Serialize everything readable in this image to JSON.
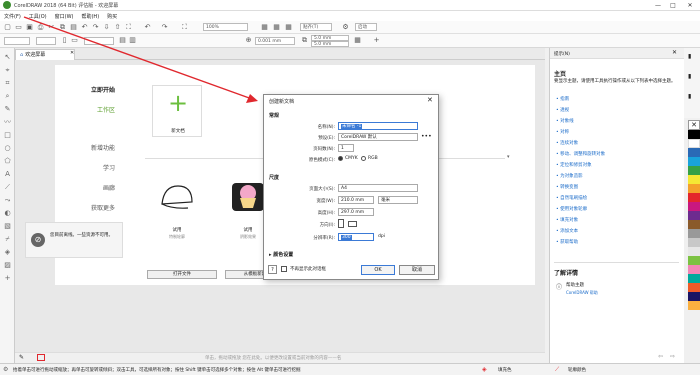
{
  "window": {
    "title": "CorelDRAW 2018 (64 Bit) 评估版 - 欢迎屏幕"
  },
  "menu": [
    "文件(F)",
    "工具(O)",
    "窗口(W)",
    "帮助(H)",
    "购买"
  ],
  "toolbar": {
    "zoom": "100%",
    "snap_label": "贴齐(T)",
    "launch_label": "启动",
    "nudge": "0.001 mm",
    "dup_x": "5.0 mm",
    "dup_y": "5.0 mm"
  },
  "tab": {
    "label": "欢迎屏幕"
  },
  "welcome": {
    "nav": [
      "立即开始",
      "工作区",
      "新增功能",
      "学习",
      "画廊",
      "获取更多"
    ],
    "new_doc": "新文档",
    "tpl1": "试用",
    "tpl1_sub": "特制轮廓",
    "tpl2": "试用",
    "tpl2_sub": "阴影效果",
    "offline": "您目前离线。一些资源不可用。",
    "open_btn": "打开文件",
    "tpl_btn": "从模板新建"
  },
  "dialog": {
    "title": "创建新文档",
    "sec_general": "常规",
    "name_label": "名称(N):",
    "name_value": "未命名 -1",
    "preset_label": "预设(E):",
    "preset_value": "CorelDRAW 默认",
    "pages_label": "页码数(N):",
    "pages_value": "1",
    "color_label": "原色模式(C):",
    "cmyk": "CMYK",
    "rgb": "RGB",
    "sec_size": "尺度",
    "pagesize_label": "页面大小(S):",
    "pagesize_value": "A4",
    "width_label": "宽度(W):",
    "width_value": "210.0 mm",
    "unit_value": "毫米",
    "height_label": "高度(H):",
    "height_value": "297.0 mm",
    "orient_label": "方向(I):",
    "res_label": "分辨率(R):",
    "res_value": "300",
    "dpi": "dpi",
    "sec_color": "颜色设置",
    "dontshow": "不再显示此对话框",
    "ok": "OK",
    "cancel": "取消"
  },
  "panel": {
    "header_tab": "提示(N)",
    "title": "主页",
    "intro": "要显示主题，请使用工具执行操作或从以下列表中选择主题。",
    "links": [
      "指南",
      "透视",
      "对象线",
      "对称",
      "连续对象",
      "移动、调整和旋转对象",
      "定位和修剪对象",
      "为对象造影",
      "转换变图",
      "自然笔刷描绘",
      "使用对象轮廓",
      "填充对象",
      "添加文本",
      "获取帮助"
    ],
    "learn_more": "了解详情",
    "help_topic": "帮助主题",
    "help_sub": "CorelDRAW 帮助"
  },
  "canvas": {
    "hint": "单击，拖动或拖放 您在此处。以便更改设置或当前对象的内容——名"
  },
  "status": {
    "text": "抬着单击可进行拖动或缩放；再单击可旋转或倾斜；双击工具，可选择所有对象；按住 Shift 键单击可选择多个对象；按住 Alt 键单击可进行挖掘",
    "fill": "填充色",
    "outline": "轮廓颜色"
  },
  "colors": {
    "accent": "#5a9e2b",
    "link": "#1a6bc9",
    "arrow": "#e0282e"
  }
}
